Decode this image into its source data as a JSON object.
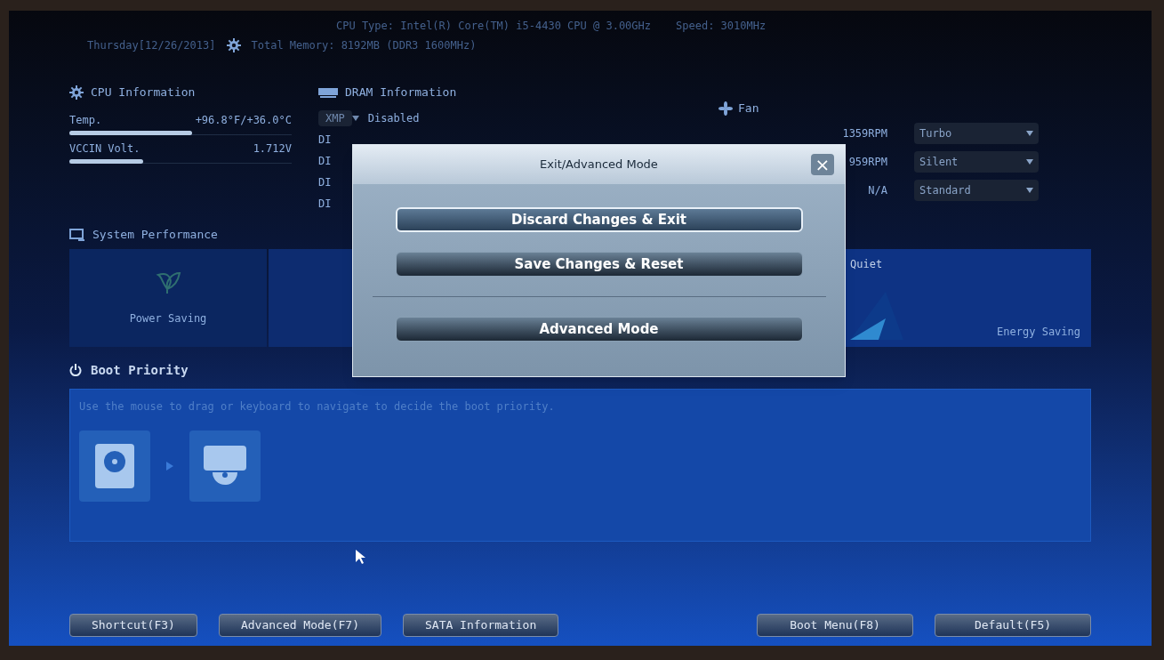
{
  "header": {
    "cpu_type": "CPU Type: Intel(R) Core(TM) i5-4430 CPU @ 3.00GHz",
    "speed": "Speed: 3010MHz",
    "date": "Thursday[12/26/2013]",
    "total_memory": "Total Memory: 8192MB (DDR3 1600MHz)"
  },
  "cpu_info": {
    "title": "CPU Information",
    "rows": [
      {
        "label": "Temp.",
        "value": "+96.8°F/+36.0°C",
        "level": 0.55
      },
      {
        "label": "VCCIN Volt.",
        "value": "1.712V",
        "level": 0.33
      }
    ]
  },
  "dram_info": {
    "title": "DRAM Information",
    "xmp": "XMP",
    "xmp_value": "Disabled",
    "slots": [
      "DI",
      "DI",
      "DI",
      "DI"
    ]
  },
  "fan": {
    "title": "Fan",
    "rows": [
      {
        "rpm": "1359RPM",
        "mode": "Turbo"
      },
      {
        "rpm": "959RPM",
        "mode": "Silent"
      },
      {
        "rpm": "N/A",
        "mode": "Standard"
      }
    ]
  },
  "system_performance": {
    "title": "System Performance",
    "tiles": [
      {
        "label": "Power Saving"
      }
    ],
    "mode_top": "Quiet",
    "mode_bottom": "Energy Saving"
  },
  "boot_priority": {
    "title": "Boot Priority",
    "hint": "Use the mouse to drag or keyboard to navigate to decide the boot priority.",
    "devices": [
      {
        "kind": "disk"
      },
      {
        "kind": "optical"
      }
    ]
  },
  "bottom_buttons_left": [
    "Shortcut(F3)",
    "Advanced Mode(F7)",
    "SATA Information"
  ],
  "bottom_buttons_right": [
    "Boot Menu(F8)",
    "Default(F5)"
  ],
  "dialog": {
    "title": "Exit/Advanced Mode",
    "close": "×",
    "buttons": [
      {
        "label": "Discard Changes & Exit",
        "selected": true
      },
      {
        "label": "Save Changes & Reset",
        "selected": false
      }
    ],
    "after_divider": [
      {
        "label": "Advanced Mode",
        "selected": false
      }
    ]
  }
}
